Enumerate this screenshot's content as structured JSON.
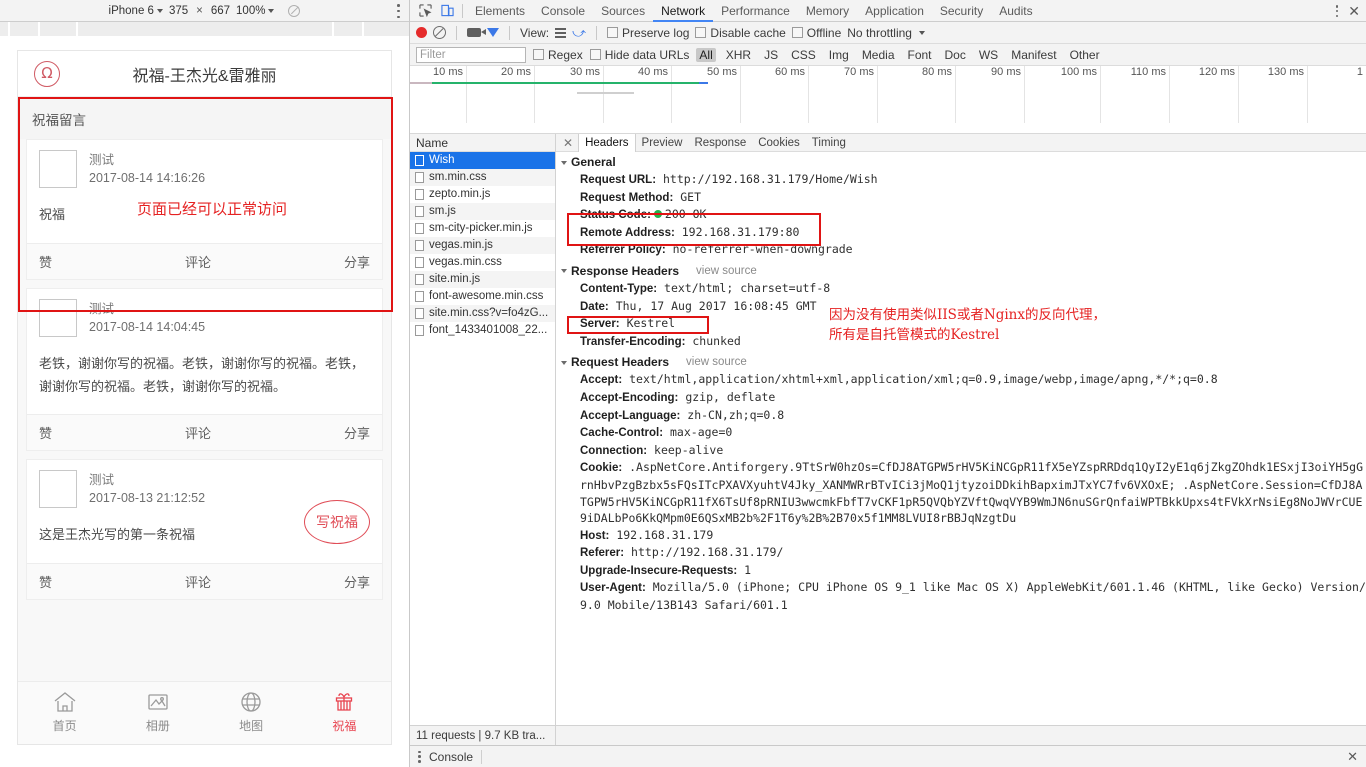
{
  "device_toolbar": {
    "device": "iPhone 6",
    "width": "375",
    "times": "×",
    "height": "667",
    "zoom": "100%",
    "throttle_icon": "no-throttling-icon",
    "menu_icon": "kebab-menu-icon"
  },
  "phone": {
    "logo_glyph": "Ω",
    "title": "祝福-王杰光&雷雅丽",
    "section_title": "祝福留言",
    "posts": [
      {
        "author": "测试",
        "time": "2017-08-14 14:16:26",
        "body": "祝福",
        "annotation": "页面已经可以正常访问",
        "like": "赞",
        "comment": "评论",
        "share": "分享"
      },
      {
        "author": "测试",
        "time": "2017-08-14 14:04:45",
        "body": "老铁，谢谢你写的祝福。老铁，谢谢你写的祝福。老铁，谢谢你写的祝福。老铁，谢谢你写的祝福。",
        "like": "赞",
        "comment": "评论",
        "share": "分享"
      },
      {
        "author": "测试",
        "time": "2017-08-13 21:12:52",
        "body": "这是王杰光写的第一条祝福",
        "write_button": "写祝福",
        "like": "赞",
        "comment": "评论",
        "share": "分享"
      }
    ],
    "tabbar": [
      {
        "label": "首页",
        "icon": "home-icon",
        "active": false
      },
      {
        "label": "相册",
        "icon": "photo-icon",
        "active": false
      },
      {
        "label": "地图",
        "icon": "globe-icon",
        "active": false
      },
      {
        "label": "祝福",
        "icon": "gift-icon",
        "active": true
      }
    ]
  },
  "devtools": {
    "tabs": [
      "Elements",
      "Console",
      "Sources",
      "Network",
      "Performance",
      "Memory",
      "Application",
      "Security",
      "Audits"
    ],
    "selected_tab": "Network",
    "more_icon": "kebab-menu-icon",
    "close_icon": "close-icon",
    "toolbar": {
      "record_icon": "record-button",
      "clear_icon": "clear-icon",
      "camera_icon": "capture-screenshots-icon",
      "filter_icon": "filter-icon",
      "view_label": "View:",
      "view_list_icon": "list-view-icon",
      "view_waterfall_icon": "waterfall-view-icon",
      "preserve_log": "Preserve log",
      "disable_cache": "Disable cache",
      "offline": "Offline",
      "throttling": "No throttling"
    },
    "filterbar": {
      "filter_placeholder": "Filter",
      "regex": "Regex",
      "hide_data_urls": "Hide data URLs",
      "types": [
        "All",
        "XHR",
        "JS",
        "CSS",
        "Img",
        "Media",
        "Font",
        "Doc",
        "WS",
        "Manifest",
        "Other"
      ],
      "selected_type": "All"
    },
    "timeline": {
      "ticks": [
        "10 ms",
        "20 ms",
        "30 ms",
        "40 ms",
        "50 ms",
        "60 ms",
        "70 ms",
        "80 ms",
        "90 ms",
        "100 ms",
        "110 ms",
        "120 ms",
        "130 ms",
        "1"
      ]
    },
    "requests": {
      "column_header": "Name",
      "rows": [
        {
          "name": "Wish",
          "selected": true
        },
        {
          "name": "sm.min.css",
          "selected": false
        },
        {
          "name": "zepto.min.js",
          "selected": false
        },
        {
          "name": "sm.js",
          "selected": false
        },
        {
          "name": "sm-city-picker.min.js",
          "selected": false
        },
        {
          "name": "vegas.min.js",
          "selected": false
        },
        {
          "name": "vegas.min.css",
          "selected": false
        },
        {
          "name": "site.min.js",
          "selected": false
        },
        {
          "name": "font-awesome.min.css",
          "selected": false
        },
        {
          "name": "site.min.css?v=fo4zG...",
          "selected": false
        },
        {
          "name": "font_1433401008_22...",
          "selected": false
        }
      ]
    },
    "detail": {
      "close_icon": "close-icon",
      "tabs": [
        "Headers",
        "Preview",
        "Response",
        "Cookies",
        "Timing"
      ],
      "selected_tab": "Headers",
      "general": {
        "title": "General",
        "rows": [
          {
            "key": "Request URL:",
            "value": "http://192.168.31.179/Home/Wish"
          },
          {
            "key": "Request Method:",
            "value": "GET"
          },
          {
            "key": "Status Code:",
            "value": "200 OK",
            "dot": true
          },
          {
            "key": "Remote Address:",
            "value": "192.168.31.179:80"
          },
          {
            "key": "Referrer Policy:",
            "value": "no-referrer-when-downgrade"
          }
        ]
      },
      "response_headers": {
        "title": "Response Headers",
        "view_source": "view source",
        "rows": [
          {
            "key": "Content-Type:",
            "value": "text/html; charset=utf-8"
          },
          {
            "key": "Date:",
            "value": "Thu, 17 Aug 2017 16:08:45 GMT"
          },
          {
            "key": "Server:",
            "value": "Kestrel"
          },
          {
            "key": "Transfer-Encoding:",
            "value": "chunked"
          }
        ]
      },
      "request_headers": {
        "title": "Request Headers",
        "view_source": "view source",
        "rows": [
          {
            "key": "Accept:",
            "value": "text/html,application/xhtml+xml,application/xml;q=0.9,image/webp,image/apng,*/*;q=0.8"
          },
          {
            "key": "Accept-Encoding:",
            "value": "gzip, deflate"
          },
          {
            "key": "Accept-Language:",
            "value": "zh-CN,zh;q=0.8"
          },
          {
            "key": "Cache-Control:",
            "value": "max-age=0"
          },
          {
            "key": "Connection:",
            "value": "keep-alive"
          },
          {
            "key": "Cookie:",
            "value": ".AspNetCore.Antiforgery.9TtSrW0hzOs=CfDJ8ATGPW5rHV5KiNCGpR11fX5eYZspRRDdq1QyI2yE1q6jZkgZOhdk1ESxjI3oiYH5gGrnHbvPzgBzbx5sFQsITcPXAVXyuhtV4Jky_XANMWRrBTvICi3jMoQ1jtyzoiDDkihBapximJTxYC7fv6VXOxE; .AspNetCore.Session=CfDJ8ATGPW5rHV5KiNCGpR11fX6TsUf8pRNIU3wwcmkFbfT7vCKF1pR5QVQbYZVftQwqVYB9WmJN6nuSGrQnfaiWPTBkkUpxs4tFVkXrNsiEg8NoJWVrCUE9iDALbPo6KkQMpm0E6QSxMB2b%2F1T6y%2B%2B70x5f1MM8LVUI8rBBJqNzgtDu"
          },
          {
            "key": "Host:",
            "value": "192.168.31.179"
          },
          {
            "key": "Referer:",
            "value": "http://192.168.31.179/"
          },
          {
            "key": "Upgrade-Insecure-Requests:",
            "value": "1"
          },
          {
            "key": "User-Agent:",
            "value": "Mozilla/5.0 (iPhone; CPU iPhone OS 9_1 like Mac OS X) AppleWebKit/601.1.46 (KHTML, like Gecko) Version/9.0 Mobile/13B143 Safari/601.1"
          }
        ]
      },
      "annotation": "因为没有使用类似IIS或者Nginx的反向代理，\n所有是自托管模式的Kestrel"
    },
    "status": {
      "summary": "11 requests  |  9.7 KB tra..."
    },
    "drawer": {
      "menu_icon": "kebab-menu-icon",
      "tab": "Console",
      "close_icon": "close-icon"
    }
  },
  "colors": {
    "accent_red": "#e01414",
    "annotation_red": "#e52222",
    "selection_blue": "#1a73e8",
    "success_green": "#22b14c",
    "brand_pink": "#e8434f"
  }
}
